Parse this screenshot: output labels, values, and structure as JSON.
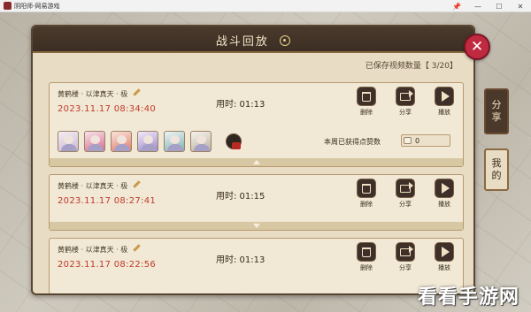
{
  "window": {
    "title": "阴阳师-网易游戏",
    "controls": [
      "📌",
      "—",
      "☐",
      "✕"
    ]
  },
  "dialog": {
    "title": "战斗回放",
    "saved_label": "已保存视频数量【 3/20】"
  },
  "records": [
    {
      "player": "黄鹤楼 · 以津真天 · 极",
      "datetime": "2023.11.17 08:34:40",
      "duration": "用时: 01:13",
      "actions": [
        "删除",
        "分享",
        "播放"
      ],
      "likes_label": "本周已获得点赞数",
      "likes_count": "0",
      "heroes": [
        "hero-1",
        "hero-2",
        "hero-3",
        "hero-4",
        "hero-5",
        "hero-6"
      ]
    },
    {
      "player": "黄鹤楼 · 以津真天 · 极",
      "datetime": "2023.11.17 08:27:41",
      "duration": "用时: 01:15",
      "actions": [
        "删除",
        "分享",
        "播放"
      ]
    },
    {
      "player": "黄鹤楼 · 以津真天 · 极",
      "datetime": "2023.11.17 08:22:56",
      "duration": "用时: 01:13",
      "actions": [
        "删除",
        "分享",
        "播放"
      ]
    }
  ],
  "side_tabs": {
    "share": [
      "分",
      "享"
    ],
    "mine": [
      "我",
      "的"
    ]
  },
  "close_label": "✕",
  "watermark": "看看手游网",
  "colors": {
    "accent_red": "#c03a2a",
    "close_button": "#c02a40",
    "dialog_bg": "#e8dcc4",
    "header_bg": "#3b2e23"
  }
}
